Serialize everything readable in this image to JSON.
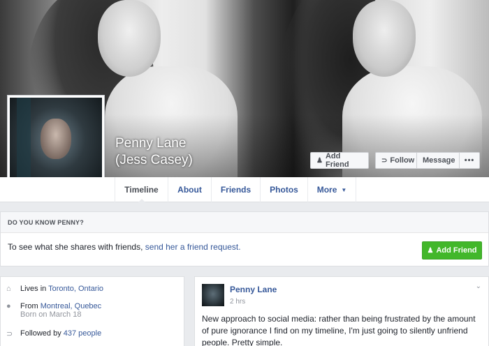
{
  "profile": {
    "name": "Penny Lane",
    "alt_name": "(Jess Casey)"
  },
  "cover_actions": {
    "add_friend": "Add Friend",
    "follow": "Follow",
    "message": "Message",
    "more": "•••"
  },
  "nav": {
    "tabs": [
      "Timeline",
      "About",
      "Friends",
      "Photos",
      "More"
    ]
  },
  "know_card": {
    "title": "DO YOU KNOW PENNY?",
    "text_prefix": "To see what she shares with friends,",
    "text_link": "send her a friend request.",
    "button": "Add Friend"
  },
  "intro": {
    "lives_prefix": "Lives in",
    "lives_link": "Toronto, Ontario",
    "from_prefix": "From",
    "from_link": "Montreal, Quebec",
    "born": "Born on March 18",
    "followed_prefix": "Followed by",
    "followed_link": "437 people"
  },
  "post": {
    "author": "Penny Lane",
    "time": "2 hrs",
    "text": "New approach to social media: rather than being frustrated by the amount of pure ignorance I find on my timeline, I'm just going to silently unfriend people. Pretty simple."
  },
  "colors": {
    "link": "#365899",
    "green_button": "#42b72a",
    "page_bg": "#e9ebee"
  }
}
